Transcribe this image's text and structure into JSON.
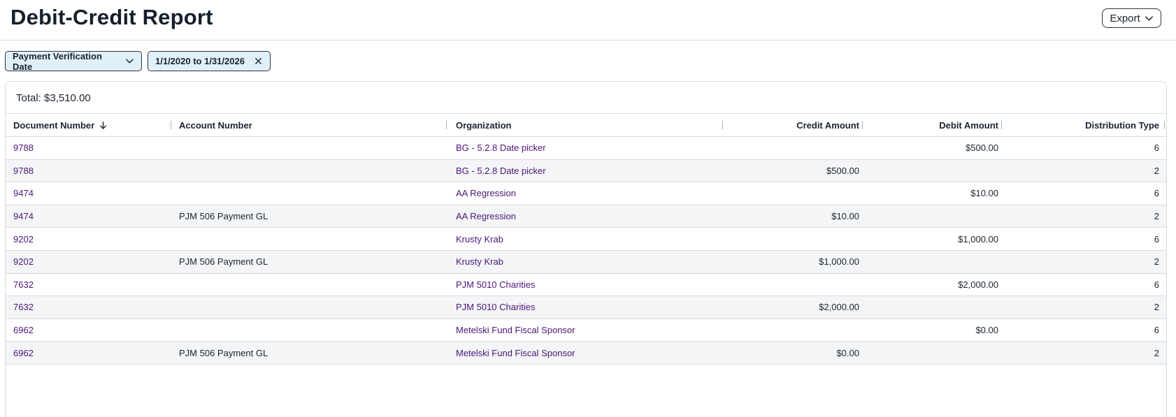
{
  "header": {
    "title": "Debit-Credit Report",
    "export_label": "Export"
  },
  "filters": {
    "date_field": "Payment Verification Date",
    "date_range": "1/1/2020 to 1/31/2026"
  },
  "summary": {
    "total": "Total: $3,510.00"
  },
  "table": {
    "columns": {
      "document_number": "Document Number",
      "account_number": "Account Number",
      "organization": "Organization",
      "credit_amount": "Credit Amount",
      "debit_amount": "Debit Amount",
      "distribution_type": "Distribution Type"
    },
    "rows": [
      {
        "doc": "9788",
        "account": "",
        "org": "BG - 5.2.8 Date picker",
        "credit": "",
        "debit": "$500.00",
        "dist": "6"
      },
      {
        "doc": "9788",
        "account": "",
        "org": "BG - 5.2.8 Date picker",
        "credit": "$500.00",
        "debit": "",
        "dist": "2"
      },
      {
        "doc": "9474",
        "account": "",
        "org": "AA Regression",
        "credit": "",
        "debit": "$10.00",
        "dist": "6"
      },
      {
        "doc": "9474",
        "account": "PJM 506 Payment GL",
        "org": "AA Regression",
        "credit": "$10.00",
        "debit": "",
        "dist": "2"
      },
      {
        "doc": "9202",
        "account": "",
        "org": "Krusty Krab",
        "credit": "",
        "debit": "$1,000.00",
        "dist": "6"
      },
      {
        "doc": "9202",
        "account": "PJM 506 Payment GL",
        "org": "Krusty Krab",
        "credit": "$1,000.00",
        "debit": "",
        "dist": "2"
      },
      {
        "doc": "7632",
        "account": "",
        "org": "PJM 5010 Charities",
        "credit": "",
        "debit": "$2,000.00",
        "dist": "6"
      },
      {
        "doc": "7632",
        "account": "",
        "org": "PJM 5010 Charities",
        "credit": "$2,000.00",
        "debit": "",
        "dist": "2"
      },
      {
        "doc": "6962",
        "account": "",
        "org": "Metelski Fund Fiscal Sponsor",
        "credit": "",
        "debit": "$0.00",
        "dist": "6"
      },
      {
        "doc": "6962",
        "account": "PJM 506 Payment GL",
        "org": "Metelski Fund Fiscal Sponsor",
        "credit": "$0.00",
        "debit": "",
        "dist": "2"
      }
    ]
  },
  "colors": {
    "link": "#4b1577",
    "chip_bg": "#e0f0fb",
    "row_alt": "#f3f5f6"
  }
}
